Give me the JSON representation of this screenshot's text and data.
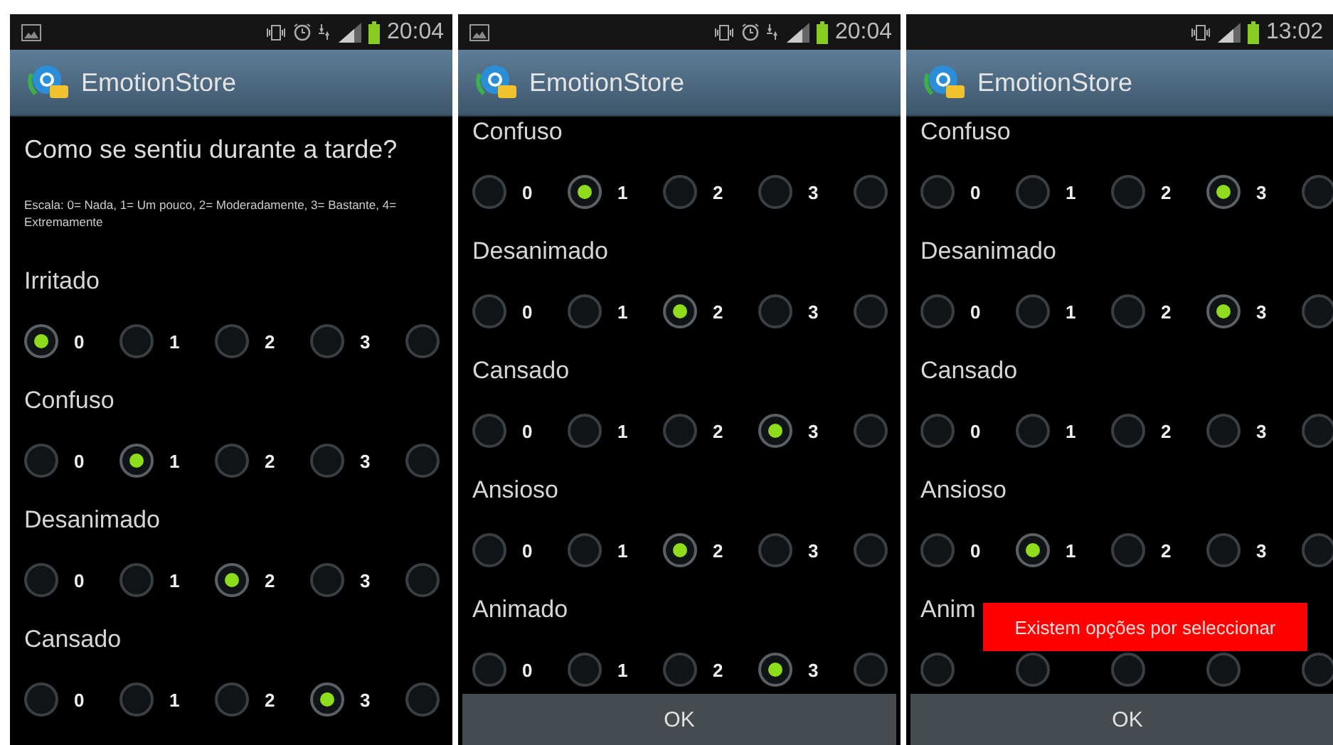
{
  "screens": [
    {
      "status_bar": {
        "time": "20:04",
        "gallery_notification": true,
        "alarm": true,
        "data_3g": true
      },
      "app_title": "EmotionStore",
      "question": "Como se sentiu durante a tarde?",
      "scale": "Escala: 0= Nada, 1= Um pouco, 2= Moderadamente, 3= Bastante, 4= Extremamente",
      "items": [
        {
          "label": "Irritado",
          "options": [
            {
              "label": "0",
              "selected": true
            },
            {
              "label": "1",
              "selected": false
            },
            {
              "label": "2",
              "selected": false
            },
            {
              "label": "3",
              "selected": false
            },
            {
              "selected": false
            }
          ]
        },
        {
          "label": "Confuso",
          "options": [
            {
              "label": "0",
              "selected": false
            },
            {
              "label": "1",
              "selected": true
            },
            {
              "label": "2",
              "selected": false
            },
            {
              "label": "3",
              "selected": false
            },
            {
              "selected": false
            }
          ]
        },
        {
          "label": "Desanimado",
          "options": [
            {
              "label": "0",
              "selected": false
            },
            {
              "label": "1",
              "selected": false
            },
            {
              "label": "2",
              "selected": true
            },
            {
              "label": "3",
              "selected": false
            },
            {
              "selected": false
            }
          ]
        },
        {
          "label": "Cansado",
          "options": [
            {
              "label": "0",
              "selected": false
            },
            {
              "label": "1",
              "selected": false
            },
            {
              "label": "2",
              "selected": false
            },
            {
              "label": "3",
              "selected": true
            },
            {
              "selected": false
            }
          ]
        }
      ]
    },
    {
      "status_bar": {
        "time": "20:04",
        "gallery_notification": true,
        "alarm": true,
        "data_3g": true
      },
      "app_title": "EmotionStore",
      "items": [
        {
          "label": "Confuso",
          "options": [
            {
              "label": "0",
              "selected": false
            },
            {
              "label": "1",
              "selected": true
            },
            {
              "label": "2",
              "selected": false
            },
            {
              "label": "3",
              "selected": false
            },
            {
              "selected": false
            }
          ]
        },
        {
          "label": "Desanimado",
          "options": [
            {
              "label": "0",
              "selected": false
            },
            {
              "label": "1",
              "selected": false
            },
            {
              "label": "2",
              "selected": true
            },
            {
              "label": "3",
              "selected": false
            },
            {
              "selected": false
            }
          ]
        },
        {
          "label": "Cansado",
          "options": [
            {
              "label": "0",
              "selected": false
            },
            {
              "label": "1",
              "selected": false
            },
            {
              "label": "2",
              "selected": false
            },
            {
              "label": "3",
              "selected": true
            },
            {
              "selected": false
            }
          ]
        },
        {
          "label": "Ansioso",
          "options": [
            {
              "label": "0",
              "selected": false
            },
            {
              "label": "1",
              "selected": false
            },
            {
              "label": "2",
              "selected": true
            },
            {
              "label": "3",
              "selected": false
            },
            {
              "selected": false
            }
          ]
        },
        {
          "label": "Animado",
          "options": [
            {
              "label": "0",
              "selected": false
            },
            {
              "label": "1",
              "selected": false
            },
            {
              "label": "2",
              "selected": false
            },
            {
              "label": "3",
              "selected": true
            },
            {
              "selected": false
            }
          ]
        }
      ],
      "ok_button": "OK"
    },
    {
      "status_bar": {
        "time": "13:02",
        "gallery_notification": false,
        "alarm": false,
        "data_3g": false
      },
      "app_title": "EmotionStore",
      "items": [
        {
          "label": "Confuso",
          "options": [
            {
              "label": "0",
              "selected": false
            },
            {
              "label": "1",
              "selected": false
            },
            {
              "label": "2",
              "selected": false
            },
            {
              "label": "3",
              "selected": true
            },
            {
              "selected": false
            }
          ]
        },
        {
          "label": "Desanimado",
          "options": [
            {
              "label": "0",
              "selected": false
            },
            {
              "label": "1",
              "selected": false
            },
            {
              "label": "2",
              "selected": false
            },
            {
              "label": "3",
              "selected": true
            },
            {
              "selected": false
            }
          ]
        },
        {
          "label": "Cansado",
          "options": [
            {
              "label": "0",
              "selected": false
            },
            {
              "label": "1",
              "selected": false
            },
            {
              "label": "2",
              "selected": false
            },
            {
              "label": "3",
              "selected": false
            },
            {
              "selected": false
            }
          ]
        },
        {
          "label": "Ansioso",
          "options": [
            {
              "label": "0",
              "selected": false
            },
            {
              "label": "1",
              "selected": true
            },
            {
              "label": "2",
              "selected": false
            },
            {
              "label": "3",
              "selected": false
            },
            {
              "selected": false
            }
          ]
        },
        {
          "label": "Anim",
          "options": [
            {
              "selected": false
            },
            {
              "selected": false
            },
            {
              "selected": false
            },
            {
              "selected": false
            },
            {
              "selected": false
            }
          ]
        }
      ],
      "ok_button": "OK",
      "toast": "Existem opções por seleccionar"
    }
  ]
}
